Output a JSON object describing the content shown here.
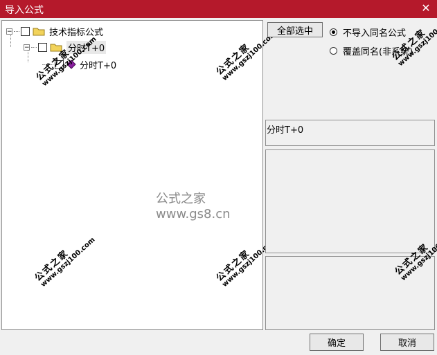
{
  "window": {
    "title": "导入公式",
    "close_glyph": "✕"
  },
  "tree": {
    "root": {
      "label": "技术指标公式",
      "expander": "−"
    },
    "child": {
      "label": "分时T+0",
      "expander": "−"
    },
    "leaf": {
      "label": "分时T+0"
    }
  },
  "options": {
    "select_all_label": "全部选中",
    "radio_skip_label": "不导入同名公式",
    "radio_overwrite_label": "覆盖同名(非系统)",
    "selected": "skip"
  },
  "info": {
    "formula_name": "分时T+0"
  },
  "footer": {
    "ok_label": "确定",
    "cancel_label": "取消"
  },
  "watermarks": {
    "text": "公式之家",
    "url": "www.gszj100.com",
    "center": "公式之家 www.gs8.cn"
  },
  "colors": {
    "titlebar": "#b5192b",
    "diamond": "#8b1fa0",
    "folder": "#f2d35b"
  }
}
